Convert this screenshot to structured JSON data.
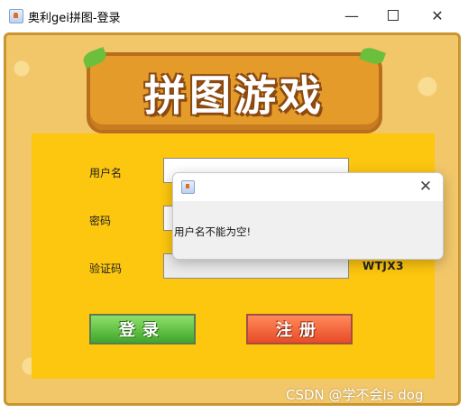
{
  "window": {
    "title": "奥利gei拼图-登录",
    "icons": [
      "java-app-icon",
      "minimize-icon",
      "maximize-icon",
      "close-icon"
    ],
    "minimize_glyph": "—",
    "close_glyph": "✕"
  },
  "logo": {
    "text": "拼图游戏"
  },
  "form": {
    "username_label": "用户名",
    "password_label": "密码",
    "captcha_label": "验证码",
    "username_value": "",
    "password_value": "",
    "captcha_value": "",
    "captcha_code": "WTJX3",
    "login_label": "登录",
    "register_label": "注册"
  },
  "dialog": {
    "message": "用户名不能为空!",
    "close_glyph": "✕"
  },
  "watermark": "CSDN @学不会is dog",
  "colors": {
    "panel": "#fdc60f",
    "frame": "#f2c76a",
    "login_button": "#3ea62a",
    "register_button": "#e84a28"
  }
}
